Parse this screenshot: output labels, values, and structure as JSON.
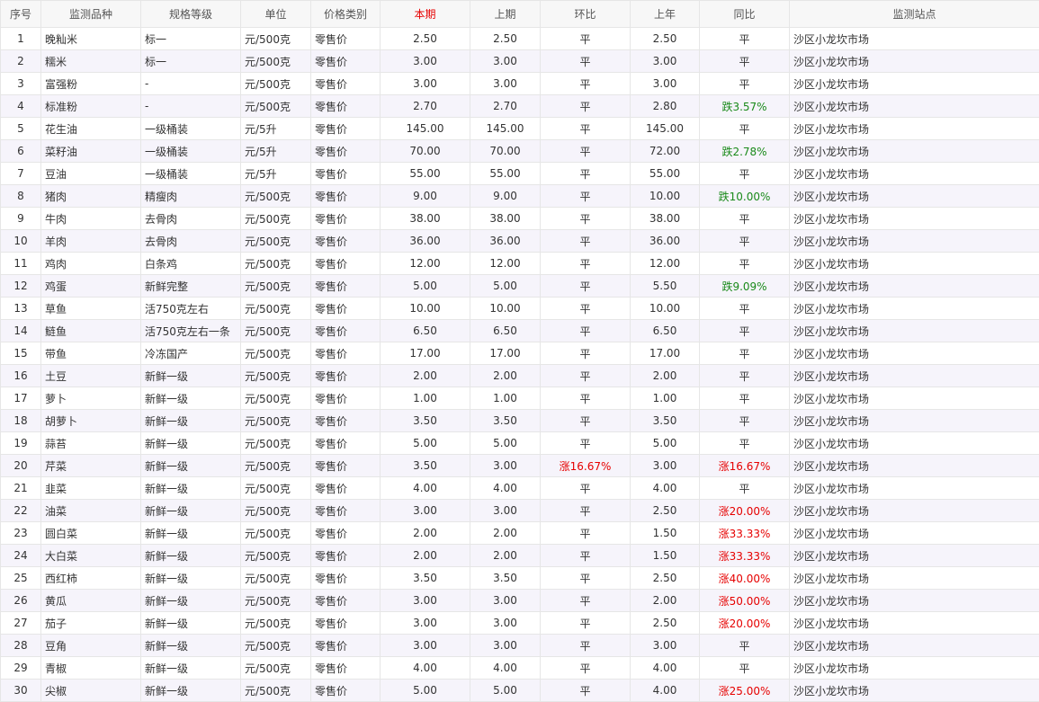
{
  "table": {
    "headers": {
      "seq": "序号",
      "item": "监测品种",
      "spec": "规格等级",
      "unit": "单位",
      "price_type": "价格类别",
      "current": "本期",
      "previous": "上期",
      "mom": "环比",
      "last_year": "上年",
      "yoy": "同比",
      "station": "监测站点"
    },
    "status_colors": {
      "rise": "#e60000",
      "fall": "#1a8a1a",
      "current_header": "#e60000"
    },
    "rows": [
      {
        "seq": "1",
        "item": "晚籼米",
        "spec": "标一",
        "unit": "元/500克",
        "price_type": "零售价",
        "current": "2.50",
        "previous": "2.50",
        "mom": "平",
        "last_year": "2.50",
        "yoy": "平",
        "station": "沙区小龙坎市场"
      },
      {
        "seq": "2",
        "item": "糯米",
        "spec": "标一",
        "unit": "元/500克",
        "price_type": "零售价",
        "current": "3.00",
        "previous": "3.00",
        "mom": "平",
        "last_year": "3.00",
        "yoy": "平",
        "station": "沙区小龙坎市场"
      },
      {
        "seq": "3",
        "item": "富强粉",
        "spec": "-",
        "unit": "元/500克",
        "price_type": "零售价",
        "current": "3.00",
        "previous": "3.00",
        "mom": "平",
        "last_year": "3.00",
        "yoy": "平",
        "station": "沙区小龙坎市场"
      },
      {
        "seq": "4",
        "item": "标准粉",
        "spec": "-",
        "unit": "元/500克",
        "price_type": "零售价",
        "current": "2.70",
        "previous": "2.70",
        "mom": "平",
        "last_year": "2.80",
        "yoy": "跌3.57%",
        "station": "沙区小龙坎市场"
      },
      {
        "seq": "5",
        "item": "花生油",
        "spec": "一级桶装",
        "unit": "元/5升",
        "price_type": "零售价",
        "current": "145.00",
        "previous": "145.00",
        "mom": "平",
        "last_year": "145.00",
        "yoy": "平",
        "station": "沙区小龙坎市场"
      },
      {
        "seq": "6",
        "item": "菜籽油",
        "spec": "一级桶装",
        "unit": "元/5升",
        "price_type": "零售价",
        "current": "70.00",
        "previous": "70.00",
        "mom": "平",
        "last_year": "72.00",
        "yoy": "跌2.78%",
        "station": "沙区小龙坎市场"
      },
      {
        "seq": "7",
        "item": "豆油",
        "spec": "一级桶装",
        "unit": "元/5升",
        "price_type": "零售价",
        "current": "55.00",
        "previous": "55.00",
        "mom": "平",
        "last_year": "55.00",
        "yoy": "平",
        "station": "沙区小龙坎市场"
      },
      {
        "seq": "8",
        "item": "猪肉",
        "spec": "精瘦肉",
        "unit": "元/500克",
        "price_type": "零售价",
        "current": "9.00",
        "previous": "9.00",
        "mom": "平",
        "last_year": "10.00",
        "yoy": "跌10.00%",
        "station": "沙区小龙坎市场"
      },
      {
        "seq": "9",
        "item": "牛肉",
        "spec": "去骨肉",
        "unit": "元/500克",
        "price_type": "零售价",
        "current": "38.00",
        "previous": "38.00",
        "mom": "平",
        "last_year": "38.00",
        "yoy": "平",
        "station": "沙区小龙坎市场"
      },
      {
        "seq": "10",
        "item": "羊肉",
        "spec": "去骨肉",
        "unit": "元/500克",
        "price_type": "零售价",
        "current": "36.00",
        "previous": "36.00",
        "mom": "平",
        "last_year": "36.00",
        "yoy": "平",
        "station": "沙区小龙坎市场"
      },
      {
        "seq": "11",
        "item": "鸡肉",
        "spec": "白条鸡",
        "unit": "元/500克",
        "price_type": "零售价",
        "current": "12.00",
        "previous": "12.00",
        "mom": "平",
        "last_year": "12.00",
        "yoy": "平",
        "station": "沙区小龙坎市场"
      },
      {
        "seq": "12",
        "item": "鸡蛋",
        "spec": "新鲜完整",
        "unit": "元/500克",
        "price_type": "零售价",
        "current": "5.00",
        "previous": "5.00",
        "mom": "平",
        "last_year": "5.50",
        "yoy": "跌9.09%",
        "station": "沙区小龙坎市场"
      },
      {
        "seq": "13",
        "item": "草鱼",
        "spec": "活750克左右",
        "unit": "元/500克",
        "price_type": "零售价",
        "current": "10.00",
        "previous": "10.00",
        "mom": "平",
        "last_year": "10.00",
        "yoy": "平",
        "station": "沙区小龙坎市场"
      },
      {
        "seq": "14",
        "item": "鲢鱼",
        "spec": "活750克左右一条",
        "unit": "元/500克",
        "price_type": "零售价",
        "current": "6.50",
        "previous": "6.50",
        "mom": "平",
        "last_year": "6.50",
        "yoy": "平",
        "station": "沙区小龙坎市场"
      },
      {
        "seq": "15",
        "item": "带鱼",
        "spec": "冷冻国产",
        "unit": "元/500克",
        "price_type": "零售价",
        "current": "17.00",
        "previous": "17.00",
        "mom": "平",
        "last_year": "17.00",
        "yoy": "平",
        "station": "沙区小龙坎市场"
      },
      {
        "seq": "16",
        "item": "土豆",
        "spec": "新鲜一级",
        "unit": "元/500克",
        "price_type": "零售价",
        "current": "2.00",
        "previous": "2.00",
        "mom": "平",
        "last_year": "2.00",
        "yoy": "平",
        "station": "沙区小龙坎市场"
      },
      {
        "seq": "17",
        "item": "萝卜",
        "spec": "新鲜一级",
        "unit": "元/500克",
        "price_type": "零售价",
        "current": "1.00",
        "previous": "1.00",
        "mom": "平",
        "last_year": "1.00",
        "yoy": "平",
        "station": "沙区小龙坎市场"
      },
      {
        "seq": "18",
        "item": "胡萝卜",
        "spec": "新鲜一级",
        "unit": "元/500克",
        "price_type": "零售价",
        "current": "3.50",
        "previous": "3.50",
        "mom": "平",
        "last_year": "3.50",
        "yoy": "平",
        "station": "沙区小龙坎市场"
      },
      {
        "seq": "19",
        "item": "蒜苔",
        "spec": "新鲜一级",
        "unit": "元/500克",
        "price_type": "零售价",
        "current": "5.00",
        "previous": "5.00",
        "mom": "平",
        "last_year": "5.00",
        "yoy": "平",
        "station": "沙区小龙坎市场"
      },
      {
        "seq": "20",
        "item": "芹菜",
        "spec": "新鲜一级",
        "unit": "元/500克",
        "price_type": "零售价",
        "current": "3.50",
        "previous": "3.00",
        "mom": "涨16.67%",
        "last_year": "3.00",
        "yoy": "涨16.67%",
        "station": "沙区小龙坎市场"
      },
      {
        "seq": "21",
        "item": "韭菜",
        "spec": "新鲜一级",
        "unit": "元/500克",
        "price_type": "零售价",
        "current": "4.00",
        "previous": "4.00",
        "mom": "平",
        "last_year": "4.00",
        "yoy": "平",
        "station": "沙区小龙坎市场"
      },
      {
        "seq": "22",
        "item": "油菜",
        "spec": "新鲜一级",
        "unit": "元/500克",
        "price_type": "零售价",
        "current": "3.00",
        "previous": "3.00",
        "mom": "平",
        "last_year": "2.50",
        "yoy": "涨20.00%",
        "station": "沙区小龙坎市场"
      },
      {
        "seq": "23",
        "item": "圆白菜",
        "spec": "新鲜一级",
        "unit": "元/500克",
        "price_type": "零售价",
        "current": "2.00",
        "previous": "2.00",
        "mom": "平",
        "last_year": "1.50",
        "yoy": "涨33.33%",
        "station": "沙区小龙坎市场"
      },
      {
        "seq": "24",
        "item": "大白菜",
        "spec": "新鲜一级",
        "unit": "元/500克",
        "price_type": "零售价",
        "current": "2.00",
        "previous": "2.00",
        "mom": "平",
        "last_year": "1.50",
        "yoy": "涨33.33%",
        "station": "沙区小龙坎市场"
      },
      {
        "seq": "25",
        "item": "西红柿",
        "spec": "新鲜一级",
        "unit": "元/500克",
        "price_type": "零售价",
        "current": "3.50",
        "previous": "3.50",
        "mom": "平",
        "last_year": "2.50",
        "yoy": "涨40.00%",
        "station": "沙区小龙坎市场"
      },
      {
        "seq": "26",
        "item": "黄瓜",
        "spec": "新鲜一级",
        "unit": "元/500克",
        "price_type": "零售价",
        "current": "3.00",
        "previous": "3.00",
        "mom": "平",
        "last_year": "2.00",
        "yoy": "涨50.00%",
        "station": "沙区小龙坎市场"
      },
      {
        "seq": "27",
        "item": "茄子",
        "spec": "新鲜一级",
        "unit": "元/500克",
        "price_type": "零售价",
        "current": "3.00",
        "previous": "3.00",
        "mom": "平",
        "last_year": "2.50",
        "yoy": "涨20.00%",
        "station": "沙区小龙坎市场"
      },
      {
        "seq": "28",
        "item": "豆角",
        "spec": "新鲜一级",
        "unit": "元/500克",
        "price_type": "零售价",
        "current": "3.00",
        "previous": "3.00",
        "mom": "平",
        "last_year": "3.00",
        "yoy": "平",
        "station": "沙区小龙坎市场"
      },
      {
        "seq": "29",
        "item": "青椒",
        "spec": "新鲜一级",
        "unit": "元/500克",
        "price_type": "零售价",
        "current": "4.00",
        "previous": "4.00",
        "mom": "平",
        "last_year": "4.00",
        "yoy": "平",
        "station": "沙区小龙坎市场"
      },
      {
        "seq": "30",
        "item": "尖椒",
        "spec": "新鲜一级",
        "unit": "元/500克",
        "price_type": "零售价",
        "current": "5.00",
        "previous": "5.00",
        "mom": "平",
        "last_year": "4.00",
        "yoy": "涨25.00%",
        "station": "沙区小龙坎市场"
      }
    ]
  }
}
